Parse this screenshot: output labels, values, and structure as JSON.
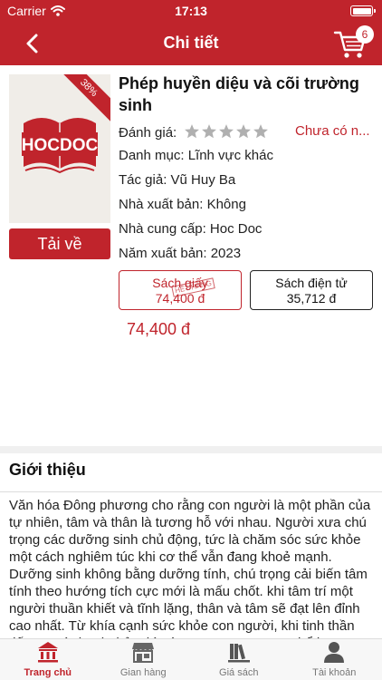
{
  "status_bar": {
    "carrier": "Carrier",
    "time": "17:13"
  },
  "nav": {
    "title": "Chi tiết",
    "cart_count": "6"
  },
  "book": {
    "discount_badge": "38%",
    "cover_logo_text": "HOCDOC",
    "title": "Phép huyền diệu và cõi trường sinh",
    "rating_label": "Đánh giá:",
    "rating_stars": 0,
    "rating_max": 5,
    "rating_text": "Chưa có n...",
    "category": "Danh mục: Lĩnh vực khác",
    "author": "Tác giả: Vũ Huy Ba",
    "publisher": "Nhà xuất bản: Không",
    "supplier": "Nhà cung cấp: Hoc Doc",
    "year": "Năm xuất bản: 2023",
    "download_label": "Tải về",
    "variants": [
      {
        "label": "Sách giấy",
        "price": "74,400 đ",
        "stamp": "HẾT HÀNG",
        "selected": true
      },
      {
        "label": "Sách điện tử",
        "price": "35,712 đ",
        "selected": false
      }
    ],
    "price": "74,400 đ"
  },
  "intro": {
    "heading": "Giới thiệu",
    "text": "Văn hóa Đông phương cho rằng con người là một phần của tự nhiên, tâm và thân là tương hỗ với nhau. Người xưa chú trọng các dưỡng sinh chủ động, tức là chăm sóc sức khỏe một cách nghiêm túc khi cơ thể vẫn đang khoẻ mạnh. Dưỡng sinh không bằng dưỡng tính, chú trọng cải biến tâm tính theo hướng tích cực mới là mấu chốt. khi tâm trí một người thuần khiết và tĩnh lặng, thân và tâm sẽ đạt lên đỉnh cao nhất. Từ khía cạnh sức khỏe con người, khi tinh thần tiếp tục và thanh thản thì các cơ quan trong cơ thể hoạt động tốt"
  },
  "tabs": [
    {
      "label": "Trang chủ",
      "icon": "bank-icon",
      "active": true
    },
    {
      "label": "Gian hàng",
      "icon": "store-icon",
      "active": false
    },
    {
      "label": "Giá sách",
      "icon": "bookshelf-icon",
      "active": false
    },
    {
      "label": "Tài khoản",
      "icon": "person-icon",
      "active": false
    }
  ],
  "colors": {
    "brand": "#c0242c",
    "tab_inactive": "#777777",
    "star_empty": "#b0b0b0"
  }
}
